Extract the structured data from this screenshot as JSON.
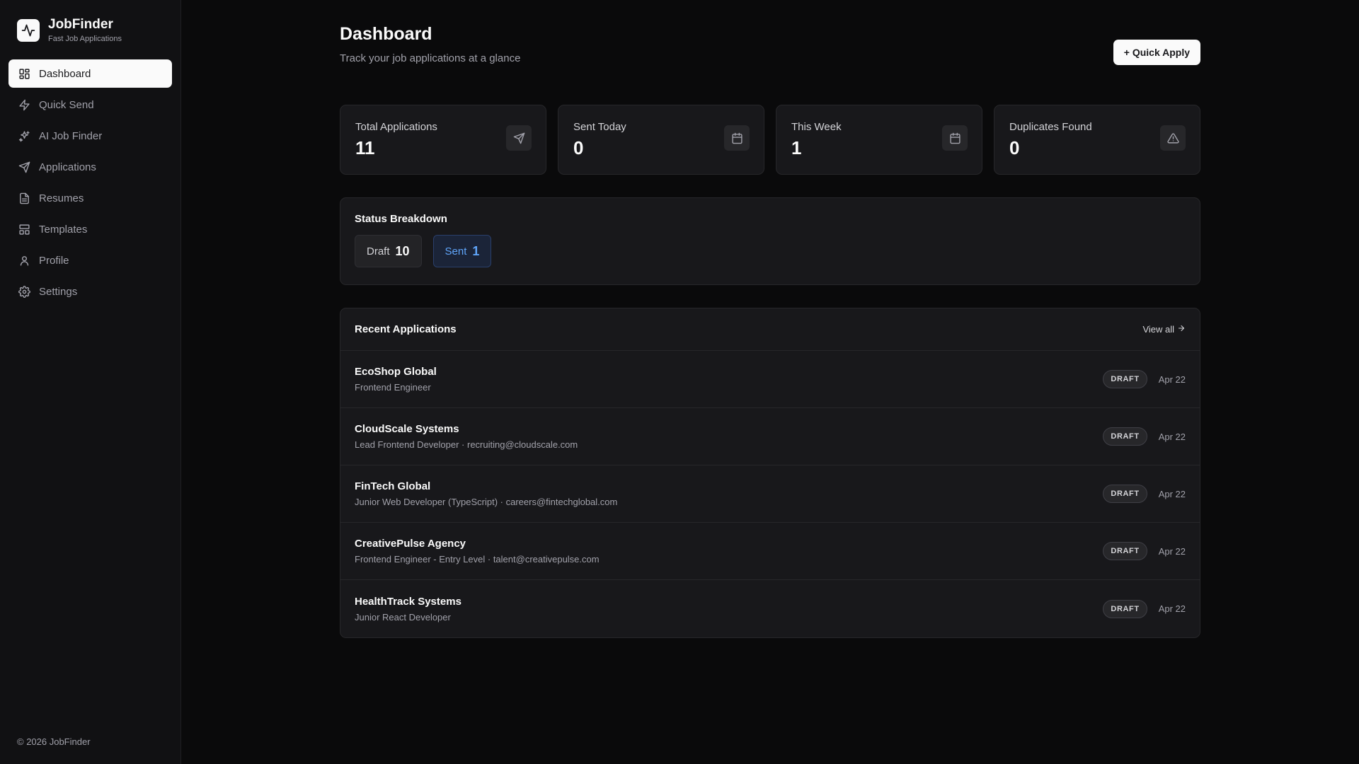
{
  "brand": {
    "name": "JobFinder",
    "subtitle": "Fast Job Applications"
  },
  "sidebar": {
    "items": [
      {
        "label": "Dashboard",
        "icon": "dashboard-icon",
        "active": true
      },
      {
        "label": "Quick Send",
        "icon": "lightning-icon"
      },
      {
        "label": "AI Job Finder",
        "icon": "sparkles-icon"
      },
      {
        "label": "Applications",
        "icon": "send-icon"
      },
      {
        "label": "Resumes",
        "icon": "document-icon"
      },
      {
        "label": "Templates",
        "icon": "template-icon"
      },
      {
        "label": "Profile",
        "icon": "user-icon"
      },
      {
        "label": "Settings",
        "icon": "gear-icon"
      }
    ],
    "footer": "© 2026 JobFinder"
  },
  "header": {
    "title": "Dashboard",
    "subtitle": "Track your job applications at a glance",
    "quick_apply_label": "+ Quick Apply"
  },
  "stats": [
    {
      "label": "Total Applications",
      "value": "11",
      "icon": "send-icon"
    },
    {
      "label": "Sent Today",
      "value": "0",
      "icon": "calendar-icon"
    },
    {
      "label": "This Week",
      "value": "1",
      "icon": "calendar-icon"
    },
    {
      "label": "Duplicates Found",
      "value": "0",
      "icon": "warning-icon"
    }
  ],
  "status_breakdown": {
    "title": "Status Breakdown",
    "items": [
      {
        "label": "Draft",
        "count": "10"
      },
      {
        "label": "Sent",
        "count": "1"
      }
    ]
  },
  "recent": {
    "title": "Recent Applications",
    "view_all_label": "View all",
    "rows": [
      {
        "company": "EcoShop Global",
        "detail": "Frontend Engineer",
        "status": "DRAFT",
        "date": "Apr 22"
      },
      {
        "company": "CloudScale Systems",
        "detail": "Lead Frontend Developer · recruiting@cloudscale.com",
        "status": "DRAFT",
        "date": "Apr 22"
      },
      {
        "company": "FinTech Global",
        "detail": "Junior Web Developer (TypeScript) · careers@fintechglobal.com",
        "status": "DRAFT",
        "date": "Apr 22"
      },
      {
        "company": "CreativePulse Agency",
        "detail": "Frontend Engineer - Entry Level · talent@creativepulse.com",
        "status": "DRAFT",
        "date": "Apr 22"
      },
      {
        "company": "HealthTrack Systems",
        "detail": "Junior React Developer",
        "status": "DRAFT",
        "date": "Apr 22"
      }
    ]
  },
  "colors": {
    "background": "#0a0a0b",
    "card": "#18181b",
    "accent_blue": "#60a5fa",
    "primary": "#fafafa"
  }
}
